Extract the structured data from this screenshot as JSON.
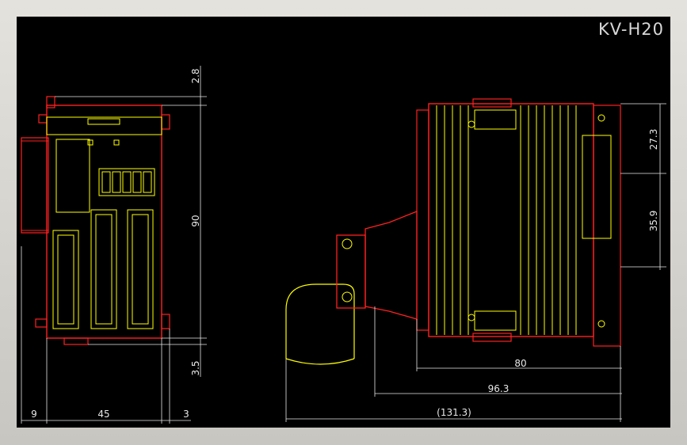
{
  "title": "KV-H20",
  "colors": {
    "background": "#000000",
    "outline": "#ff2020",
    "detail": "#ffff00",
    "dimension": "#e8e8e8",
    "title": "#d8d8d8"
  },
  "dimensions": {
    "top_gap": "2.8",
    "height": "90",
    "bottom_gap": "3.5",
    "left_width": "9",
    "body_width": "45",
    "right_gap": "3",
    "upper_section": "27.3",
    "lower_section": "35.9",
    "depth_80": "80",
    "depth_96": "96.3",
    "depth_total": "(131.3)"
  }
}
